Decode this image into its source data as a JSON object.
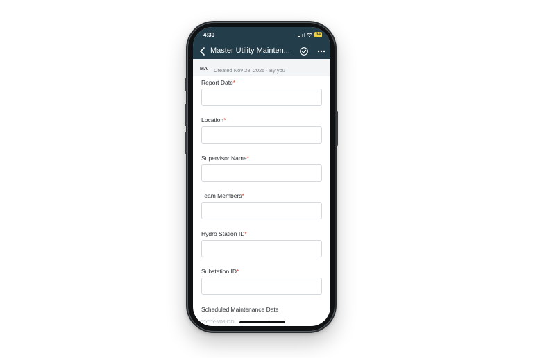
{
  "status_bar": {
    "time": "4:30",
    "battery": "34"
  },
  "header": {
    "title": "Master Utility Mainten...",
    "back_icon": "chevron-left-icon",
    "submit_icon": "check-circle-icon",
    "more_icon": "more-horizontal-icon"
  },
  "meta": {
    "avatar": "MA",
    "created": "Created Nov 28, 2025 · By you"
  },
  "form": {
    "fields": [
      {
        "label": "Report Date",
        "required": "*",
        "value": ""
      },
      {
        "label": "Location",
        "required": "*",
        "value": ""
      },
      {
        "label": "Supervisor Name",
        "required": "*",
        "value": ""
      },
      {
        "label": "Team Members",
        "required": "*",
        "value": ""
      },
      {
        "label": "Hydro Station ID",
        "required": "*",
        "value": ""
      },
      {
        "label": "Substation ID",
        "required": "*",
        "value": ""
      }
    ],
    "scheduled": {
      "label": "Scheduled Maintenance Date",
      "placeholder": "YYYY-MM-DD",
      "clear": "×"
    }
  },
  "colors": {
    "header_bg": "#233d4b",
    "required": "#d9472f",
    "battery": "#f4d03f"
  }
}
